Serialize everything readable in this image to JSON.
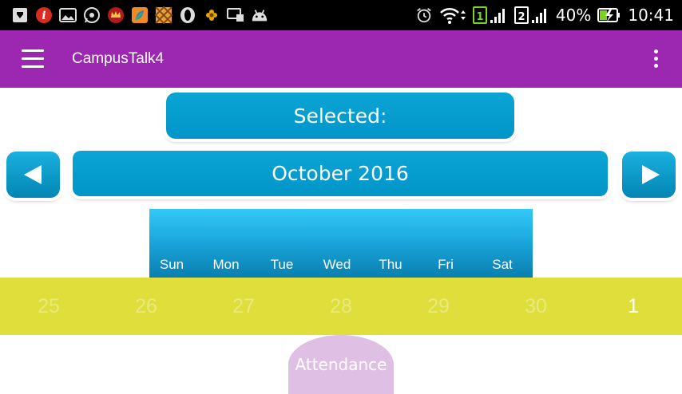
{
  "status_bar": {
    "battery_percent": "40%",
    "time": "10:41",
    "sim1_label": "1",
    "sim2_label": "2"
  },
  "app_bar": {
    "title": "CampusTalk4"
  },
  "calendar": {
    "selected_label": "Selected:",
    "month_label": "October 2016",
    "weekdays": [
      "Sun",
      "Mon",
      "Tue",
      "Wed",
      "Thu",
      "Fri",
      "Sat"
    ],
    "days": [
      {
        "label": "25",
        "in_month": false
      },
      {
        "label": "26",
        "in_month": false
      },
      {
        "label": "27",
        "in_month": false
      },
      {
        "label": "28",
        "in_month": false
      },
      {
        "label": "29",
        "in_month": false
      },
      {
        "label": "30",
        "in_month": false
      },
      {
        "label": "1",
        "in_month": true
      }
    ]
  },
  "attendance_button": {
    "label": "Attendance"
  },
  "colors": {
    "app_bar": "#9C27B0",
    "calendar_blue": "#0295c8",
    "date_row": "#dfde3a",
    "attendance_button": "#e0bfe4"
  }
}
